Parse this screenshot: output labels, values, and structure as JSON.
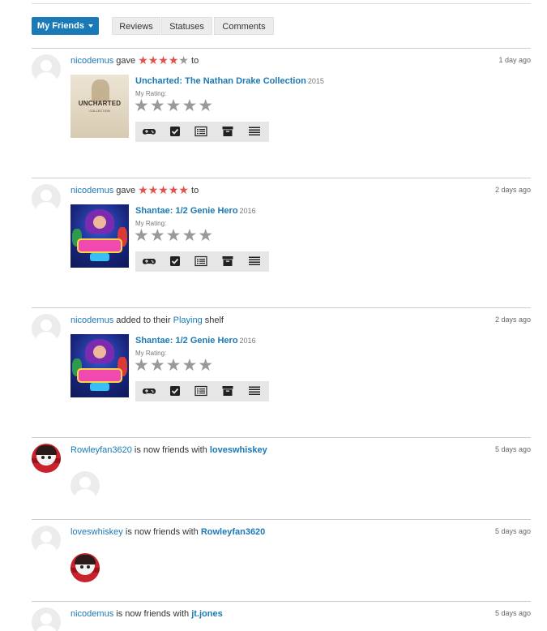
{
  "tabs": {
    "dropdown_label": "My Friends",
    "reviews": "Reviews",
    "statuses": "Statuses",
    "comments": "Comments"
  },
  "common": {
    "my_rating_label": "My Rating:",
    "gave": "gave",
    "to": "to",
    "is_now_friends_with": "is now friends with",
    "added_to_their": "added to their",
    "shelf": "shelf"
  },
  "feed": [
    {
      "type": "rating",
      "user": "nicodemus",
      "stars": 4,
      "max_stars": 5,
      "time": "1 day ago",
      "game": "Uncharted: The Nathan Drake Collection",
      "year": "2015",
      "cover_text": "UNCHARTED",
      "cover_sub": "COLLECTION"
    },
    {
      "type": "rating",
      "user": "nicodemus",
      "stars": 5,
      "max_stars": 5,
      "time": "2 days ago",
      "game": "Shantae: 1/2 Genie Hero",
      "year": "2016"
    },
    {
      "type": "shelf",
      "user": "nicodemus",
      "shelf": "Playing",
      "time": "2 days ago",
      "game": "Shantae: 1/2 Genie Hero",
      "year": "2016"
    },
    {
      "type": "friends",
      "user": "Rowleyfan3620",
      "friend": "loveswhiskey",
      "time": "5 days ago"
    },
    {
      "type": "friends",
      "user": "loveswhiskey",
      "friend": "Rowleyfan3620",
      "time": "5 days ago"
    },
    {
      "type": "friends",
      "user": "nicodemus",
      "friend": "jt.jones",
      "time": "5 days ago"
    }
  ],
  "colors": {
    "accent": "#1a7ab8",
    "star_on": "#e0524b",
    "star_off": "#999999"
  },
  "icons": {
    "actions": [
      "gamepad-icon",
      "checkbox-icon",
      "list-icon",
      "archive-icon",
      "menu-icon"
    ]
  }
}
